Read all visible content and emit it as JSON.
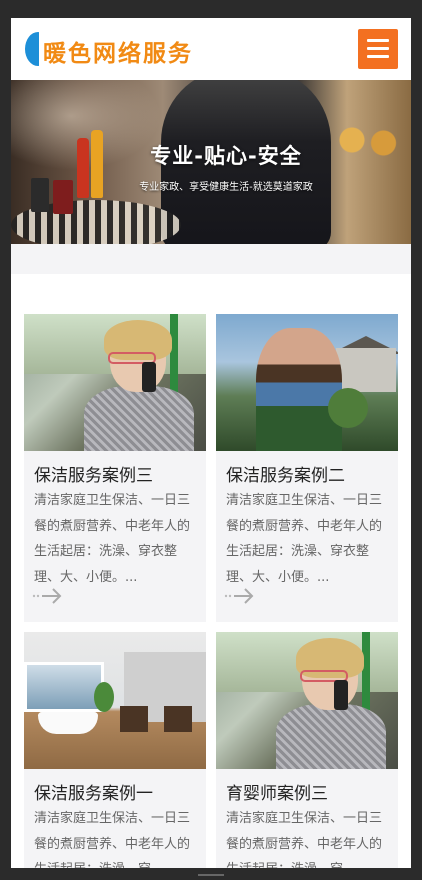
{
  "header": {
    "logo_text": "暖色网络服务",
    "menu_icon": "hamburger-icon",
    "accent_color": "#f37021"
  },
  "banner": {
    "title": "专业-贴心-安全",
    "subtitle": "专业家政、享受健康生活-就选莫道家政"
  },
  "cases": [
    {
      "title": "保洁服务案例三",
      "desc": "清洁家庭卫生保洁、一日三餐的煮厨营养、中老年人的生活起居：洗澡、穿衣整理、大、小便。...",
      "image": "woman-on-phone"
    },
    {
      "title": "保洁服务案例二",
      "desc": "清洁家庭卫生保洁、一日三餐的煮厨营养、中老年人的生活起居：洗澡、穿衣整理、大、小便。...",
      "image": "gardener"
    },
    {
      "title": "保洁服务案例一",
      "desc": "清洁家庭卫生保洁、一日三餐的煮厨营养、中老年人的生活起居：洗澡、穿",
      "image": "bathroom"
    },
    {
      "title": "育婴师案例三",
      "desc": "清洁家庭卫生保洁、一日三餐的煮厨营养、中老年人的生活起居：洗澡、穿",
      "image": "woman-on-phone"
    }
  ],
  "more_icon": "arrow-right-icon"
}
